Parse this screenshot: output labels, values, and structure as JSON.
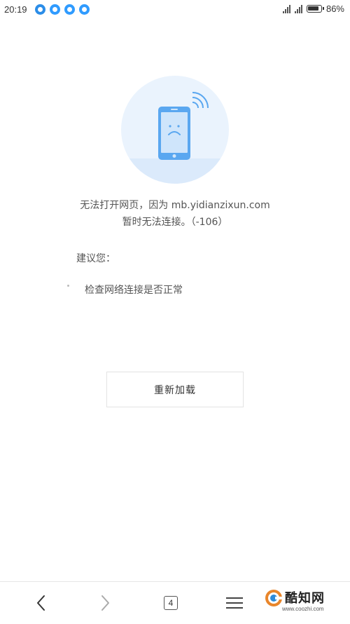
{
  "status_bar": {
    "time": "20:19",
    "battery": "86%",
    "notification_icons": [
      "app-icon",
      "qq-browser-icon",
      "qq-browser-icon",
      "qq-browser-icon"
    ]
  },
  "error": {
    "line1": "无法打开网页，因为 mb.yidianzixun.com",
    "line2": "暂时无法连接。（-106）"
  },
  "suggestions": {
    "title": "建议您：",
    "items": [
      "检查网络连接是否正常"
    ]
  },
  "reload_label": "重新加载",
  "bottom_nav": {
    "tab_count": "4"
  },
  "watermark": {
    "brand": "酷知网",
    "url": "www.coozhi.com"
  },
  "colors": {
    "accent": "#5aa7f0",
    "illustration_bg": "#eaf3fd"
  }
}
